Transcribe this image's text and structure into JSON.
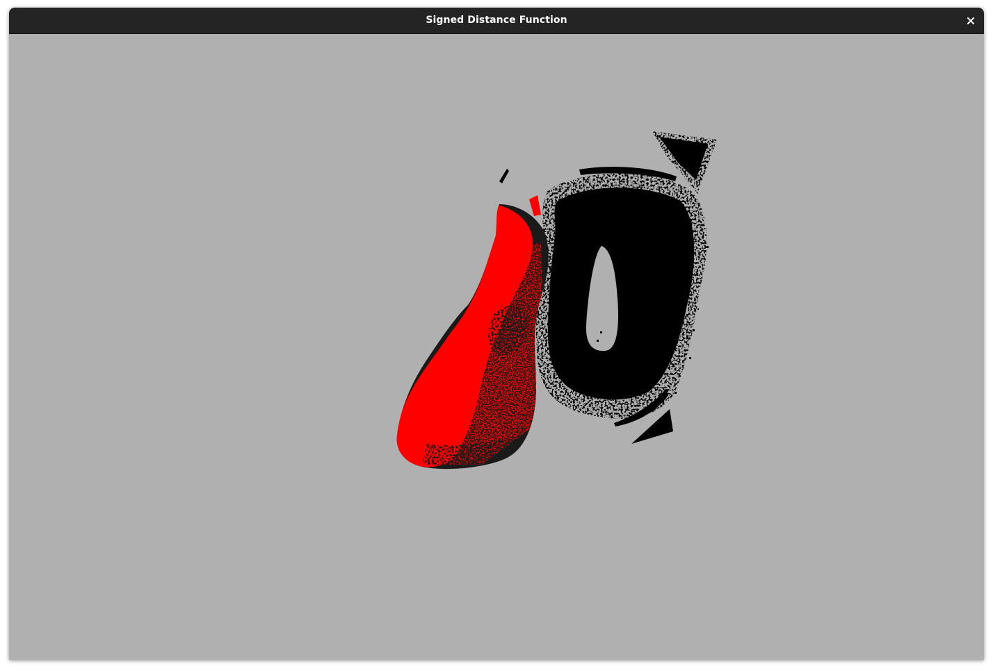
{
  "window": {
    "title": "Signed Distance Function",
    "close_icon": "close-icon"
  },
  "viewport": {
    "background_color": "#b0b0b0",
    "mesh_colors": {
      "surface_red": "#ff0000",
      "surface_dark": "#1a1a1a",
      "point_cloud": "#000000"
    }
  }
}
